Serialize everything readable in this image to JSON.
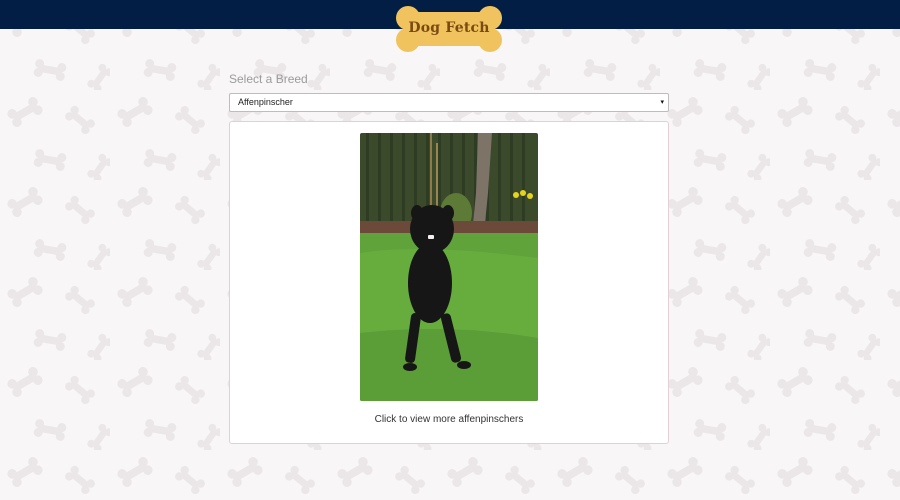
{
  "header": {
    "app_title": "Dog Fetch",
    "bar_color": "#021e44",
    "logo_color": "#f0c35e",
    "logo_icon": "bone-icon"
  },
  "breed_picker": {
    "label": "Select a Breed",
    "selected": "Affenpinscher",
    "caret": "▾"
  },
  "gallery": {
    "image_subject": "affenpinscher-photo",
    "caption": "Click to view more affenpinschers"
  },
  "background": {
    "pattern_icon": "bone-icon",
    "color": "#f8f6f7"
  }
}
